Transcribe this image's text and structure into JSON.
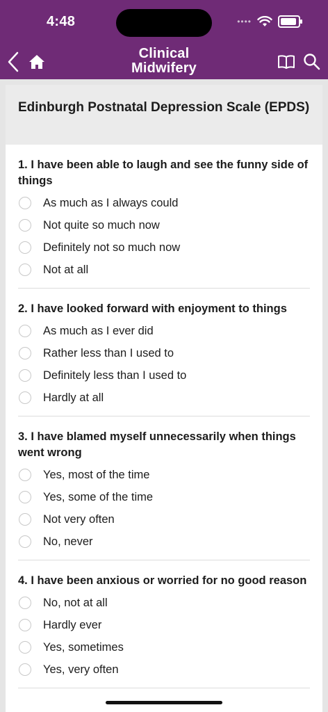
{
  "status_bar": {
    "time": "4:48"
  },
  "nav": {
    "title_line1": "Clinical",
    "title_line2": "Midwifery"
  },
  "page": {
    "title": "Edinburgh Postnatal Depression Scale (EPDS)"
  },
  "questions": [
    {
      "title": "1. I have been able to laugh and see the funny side of things",
      "options": [
        "As much as I always could",
        "Not quite so much now",
        "Definitely not so much now",
        "Not at all"
      ]
    },
    {
      "title": "2. I have looked forward with enjoyment to things",
      "options": [
        "As much as I ever did",
        "Rather less than I used to",
        "Definitely less than I used to",
        "Hardly at all"
      ]
    },
    {
      "title": "3. I have blamed myself unnecessarily when things went wrong",
      "options": [
        "Yes, most of the time",
        "Yes, some of the time",
        "Not very often",
        "No, never"
      ]
    },
    {
      "title": "4. I have been anxious or worried for no good reason",
      "options": [
        "No, not at all",
        "Hardly ever",
        "Yes, sometimes",
        "Yes, very often"
      ]
    }
  ],
  "colors": {
    "brand": "#6f2b76",
    "card": "#ffffff",
    "header_bg": "#ebebeb",
    "background": "#e5e5e5"
  }
}
